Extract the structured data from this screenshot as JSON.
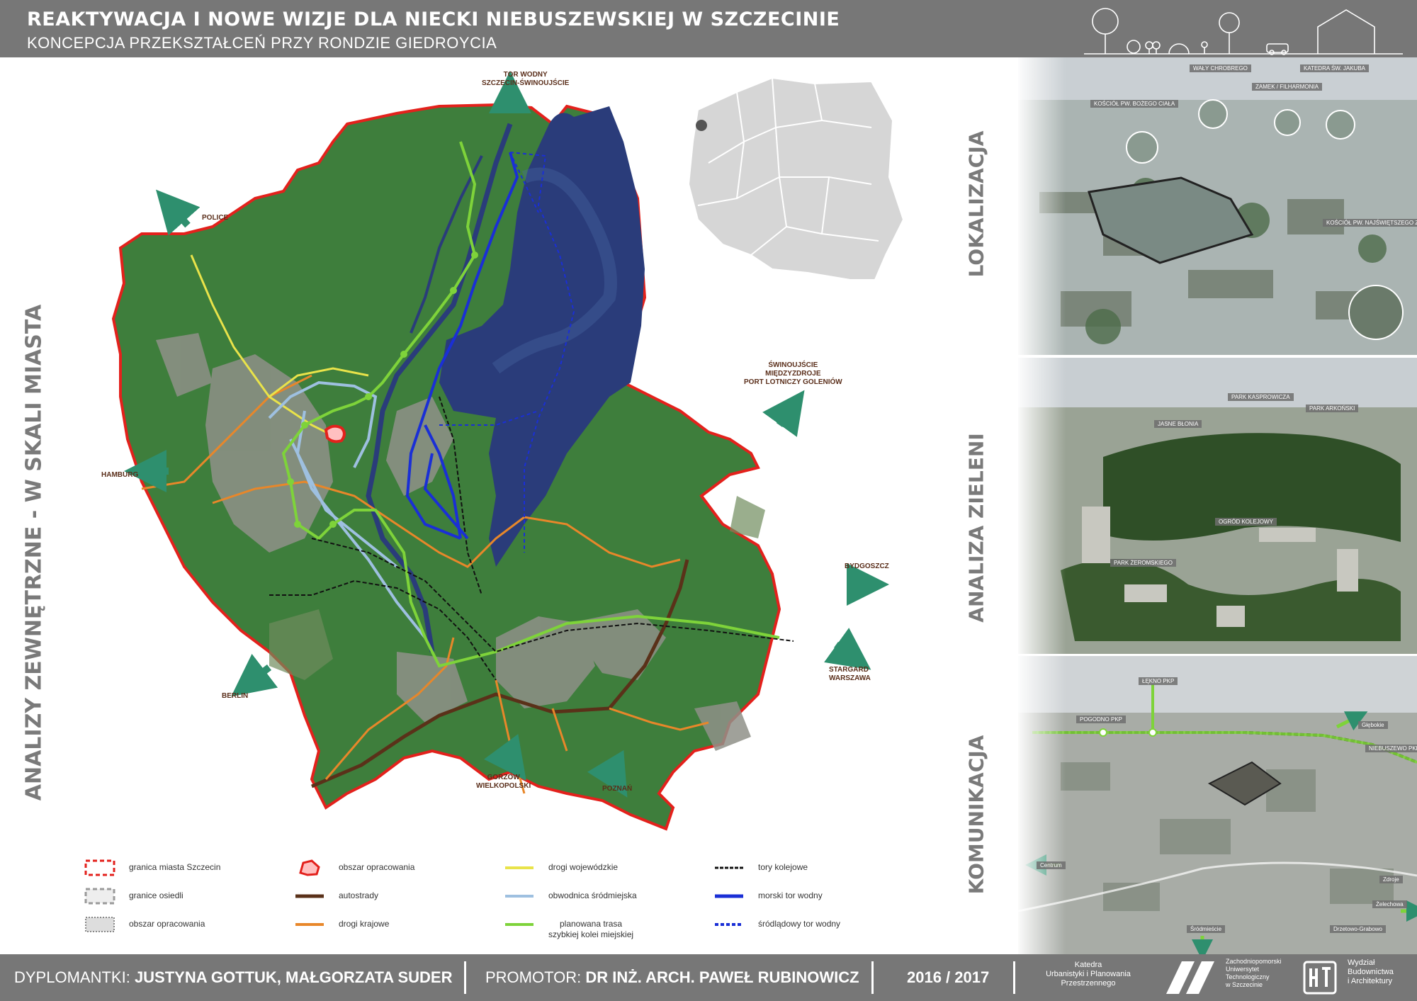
{
  "header": {
    "title": "REAKTYWACJA I NOWE WIZJE DLA NIECKI NIEBUSZEWSKIEJ W SZCZECINIE",
    "subtitle": "KONCEPCJA PRZEKSZTAŁCEŃ PRZY RONDZIE GIEDROYCIA"
  },
  "side_titles": {
    "main": "ANALIZY ZEWNĘTRZNE - W SKALI MIASTA",
    "lokalizacja": "LOKALIZACJA",
    "zieleni": "ANALIZA ZIELENI",
    "komunikacja": "KOMUNIKACJA"
  },
  "map_labels": {
    "tor_wodny": "TOR WODNY\nSZCZECIN-ŚWINOUJŚCIE",
    "police": "POLICE",
    "hamburg": "HAMBURG",
    "berlin": "BERLIN",
    "swinoujscie": "ŚWINOUJŚCIE\nMIĘDZYZDROJE\nPORT LOTNICZY GOLENIÓW",
    "bydgoszcz": "BYDGOSZCZ",
    "stargard": "STARGARD\nWARSZAWA",
    "gorzow": "GORZÓW\nWIELKOPOLSKI",
    "poznan": "POZNAŃ"
  },
  "photo_tags": {
    "lok": [
      "WAŁY CHROBREGO",
      "KATEDRA ŚW. JAKUBA",
      "ZAMEK / FILHARMONIA",
      "KOŚCIÓŁ PW. BOŻEGO CIAŁA",
      "KOŚCIÓŁ PW. NAJŚWIĘTSZEGO ZBAWICIELA"
    ],
    "ziel": [
      "PARK KASPROWICZA",
      "JASNE BŁONIA",
      "PARK ARKOŃSKI",
      "OGRÓD KOLEJOWY",
      "PARK ŻEROMSKIEGO"
    ],
    "kom": [
      "POGODNO PKP",
      "ŁĘKNO PKP",
      "Głębokie",
      "NIEBUSZEWO PKP",
      "Centrum",
      "Śródmieście",
      "Zdroje",
      "Drzetowo-Grabowo",
      "Żelechowa"
    ]
  },
  "legend": [
    {
      "label": "granica miasta Szczecin",
      "symbol": "dash-red-box"
    },
    {
      "label": "granice osiedli",
      "symbol": "dash-grey-box"
    },
    {
      "label": "obszar opracowania",
      "symbol": "dot-grey-box"
    },
    {
      "label": "obszar opracowania",
      "symbol": "red-blob"
    },
    {
      "label": "autostrady",
      "symbol": "line-brown"
    },
    {
      "label": "drogi krajowe",
      "symbol": "line-orange"
    },
    {
      "label": "drogi wojewódzkie",
      "symbol": "line-yellow"
    },
    {
      "label": "obwodnica śródmiejska",
      "symbol": "line-lightblue"
    },
    {
      "label": "planowana trasa\nszybkiej kolei miejskiej",
      "symbol": "line-green"
    },
    {
      "label": "tory kolejowe",
      "symbol": "line-rail"
    },
    {
      "label": "morski tor wodny",
      "symbol": "line-blue"
    },
    {
      "label": "śródlądowy tor wodny",
      "symbol": "line-blue-dash"
    }
  ],
  "footer": {
    "authors_prefix": "DYPLOMANTKI:",
    "authors": "JUSTYNA GOTTUK, MAŁGORZATA SUDER",
    "promotor_prefix": "PROMOTOR:",
    "promotor": "DR INŻ. ARCH. PAWEŁ RUBINOWICZ",
    "year": "2016 / 2017",
    "katedra": "Katedra\nUrbanistyki i Planowania\nPrzestrzennego",
    "university": "Zachodniopomorski\nUniwersytet\nTechnologiczny\nw Szczecinie",
    "faculty": "Wydział\nBudownictwa\ni Architektury"
  },
  "colors": {
    "header_bg": "#777777",
    "boundary": "#e3211c",
    "motorway": "#5a3119",
    "national": "#e8872a",
    "regional": "#e9e34a",
    "ring": "#9ec0e0",
    "rail_planned": "#7ed33a",
    "sea_route": "#1a2fd6",
    "river": "#2a3c7a",
    "arrow": "#2e8f6e"
  }
}
